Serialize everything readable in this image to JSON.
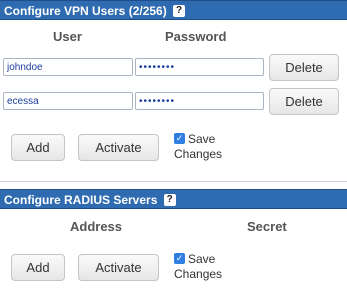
{
  "vpn": {
    "title": "Configure VPN Users (2/256)",
    "col_user": "User",
    "col_password": "Password",
    "rows": [
      {
        "user": "johndoe",
        "password": "••••••••",
        "delete_label": "Delete"
      },
      {
        "user": "ecessa",
        "password": "••••••••",
        "delete_label": "Delete"
      }
    ],
    "add_label": "Add",
    "activate_label": "Activate",
    "save_line1": "Save",
    "save_line2": "Changes",
    "save_checked": true
  },
  "radius": {
    "title": "Configure RADIUS Servers",
    "col_address": "Address",
    "col_secret": "Secret",
    "add_label": "Add",
    "activate_label": "Activate",
    "save_line1": "Save",
    "save_line2": "Changes",
    "save_checked": true
  },
  "icons": {
    "help": "question-icon",
    "check": "checkbox-checked-icon"
  },
  "colors": {
    "header_bg": "#2f6bb0",
    "accent": "#2f7fe0"
  }
}
